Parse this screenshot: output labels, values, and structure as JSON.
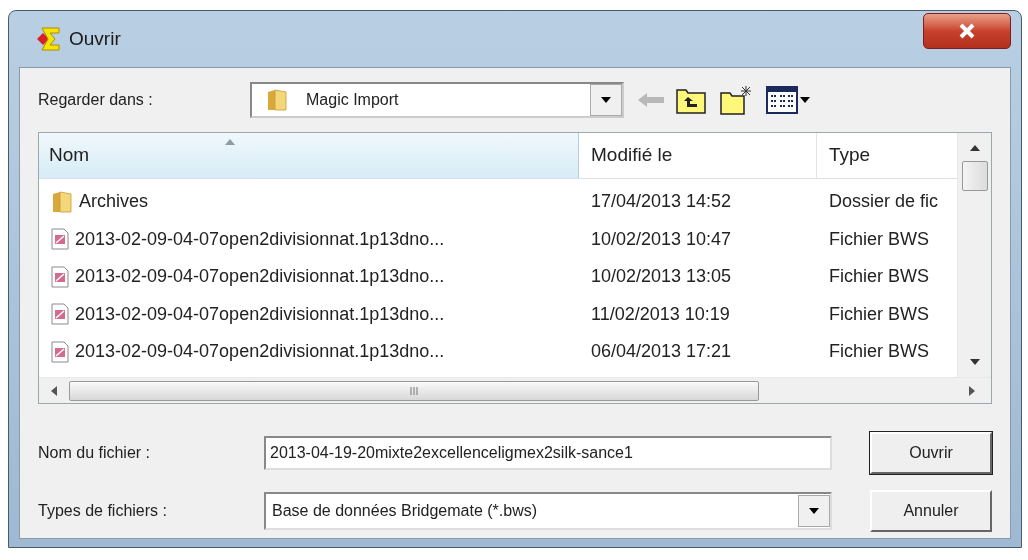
{
  "window": {
    "title": "Ouvrir"
  },
  "look_in": {
    "label": "Regarder dans :",
    "value": "Magic Import"
  },
  "file_list": {
    "columns": [
      "Nom",
      "Modifié le",
      "Type"
    ],
    "rows": [
      {
        "kind": "folder",
        "name": "Archives",
        "modified": "17/04/2013 14:52",
        "type": "Dossier de fic"
      },
      {
        "kind": "file",
        "name": "2013-02-09-04-07open2divisionnat.1p13dno...",
        "modified": "10/02/2013 10:47",
        "type": "Fichier BWS"
      },
      {
        "kind": "file",
        "name": "2013-02-09-04-07open2divisionnat.1p13dno...",
        "modified": "10/02/2013 13:05",
        "type": "Fichier BWS"
      },
      {
        "kind": "file",
        "name": "2013-02-09-04-07open2divisionnat.1p13dno...",
        "modified": "11/02/2013 10:19",
        "type": "Fichier BWS"
      },
      {
        "kind": "file",
        "name": "2013-02-09-04-07open2divisionnat.1p13dno...",
        "modified": "06/04/2013 17:21",
        "type": "Fichier BWS"
      }
    ]
  },
  "file_name": {
    "label": "Nom du fichier :",
    "value": "2013-04-19-20mixte2excellenceligmex2silk-sance1"
  },
  "file_type": {
    "label": "Types de fichiers :",
    "value": "Base de données Bridgemate (*.bws)"
  },
  "buttons": [
    "Ouvrir",
    "Annuler"
  ]
}
